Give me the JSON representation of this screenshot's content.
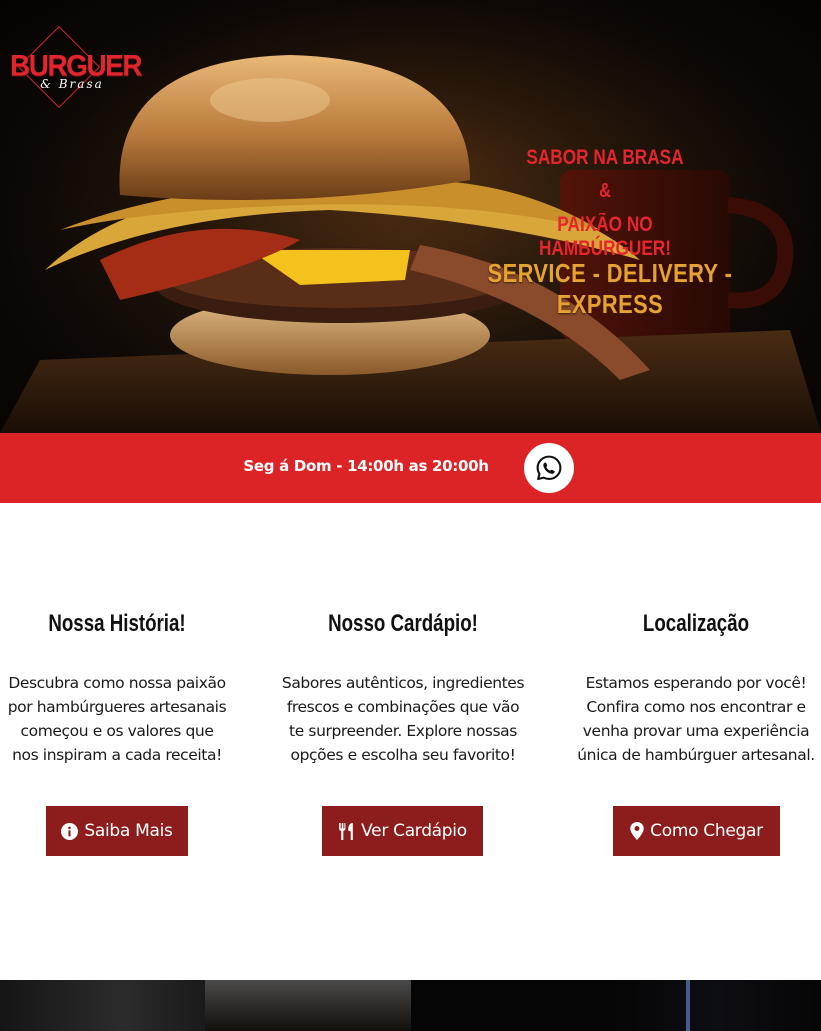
{
  "brand": {
    "logo_main": "BURGUER",
    "logo_script": "& Brasa"
  },
  "hero": {
    "tagline_line1": "Sabor na brasa",
    "tagline_line2": "&",
    "tagline_line3": "Paixão no hambúrguer!",
    "services": "SERVICE - DELIVERY - EXPRESS"
  },
  "hours_bar": {
    "hours": "Seg á Dom - 14:00h as 20:00h",
    "whatsapp_icon": "whatsapp-icon"
  },
  "cards": [
    {
      "title": "Nossa História!",
      "text": "Descubra como nossa paixão por hambúrgueres artesanais começou e os valores que nos inspiram a cada receita!",
      "button": "Saiba Mais",
      "icon": "info-icon"
    },
    {
      "title": "Nosso Cardápio!",
      "text": "Sabores autênticos, ingredientes frescos e combinações que vão te surpreender. Explore nossas opções e escolha seu favorito!",
      "button": "Ver Cardápio",
      "icon": "utensils-icon"
    },
    {
      "title": "Localização",
      "text": "Estamos esperando por você! Confira como nos encontrar e venha provar uma experiência única de hambúrguer artesanal.",
      "button": "Como Chegar",
      "icon": "map-pin-icon"
    }
  ],
  "colors": {
    "brand_red": "#dc2426",
    "button_dark_red": "#8d1c1c",
    "services_gold": "#e7a331"
  }
}
